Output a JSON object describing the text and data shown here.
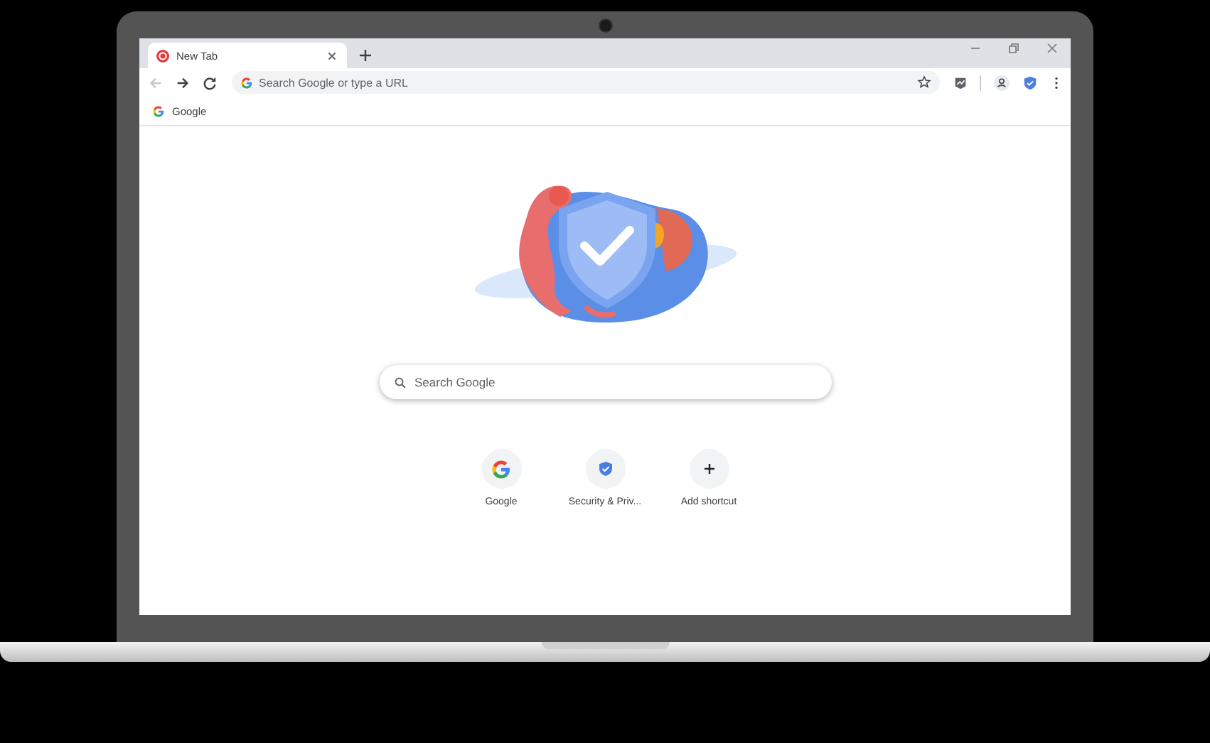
{
  "tabs": [
    {
      "title": "New Tab",
      "selected": true
    }
  ],
  "navigation": {
    "back_disabled": true
  },
  "address_bar": {
    "placeholder": "Search Google or type a URL"
  },
  "bookmarks": [
    {
      "label": "Google"
    }
  ],
  "search": {
    "placeholder": "Search Google"
  },
  "shortcuts": [
    {
      "label": "Google",
      "kind": "google"
    },
    {
      "label": "Security & Priv...",
      "kind": "shield"
    },
    {
      "label": "Add shortcut",
      "kind": "add"
    }
  ]
}
